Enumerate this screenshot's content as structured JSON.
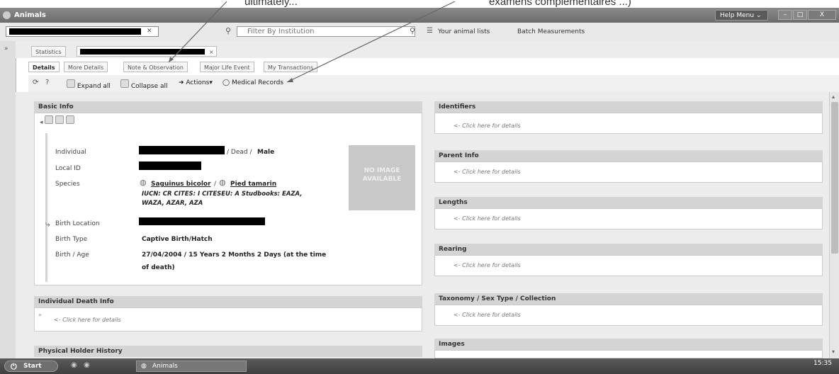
{
  "annotations": {
    "left_fragment": "ultimately...",
    "right_fragment": "examens complémentaires ...)"
  },
  "window": {
    "title": "Animals",
    "help_menu": "Help Menu",
    "min": "–",
    "max": "□",
    "close": "X"
  },
  "toolbar": {
    "filter_placeholder": "Filter By Institution",
    "animal_lists": "Your animal lists",
    "batch_measurements": "Batch Measurements"
  },
  "tabs_top": {
    "statistics": "Statistics",
    "close": "×"
  },
  "tabs": [
    "Details",
    "More Details",
    "Note & Observation",
    "Major Life Event",
    "My Transactions"
  ],
  "actions": {
    "expand_all": "Expand all",
    "collapse_all": "Collapse all",
    "actions": "Actions",
    "medical_records": "Medical Records"
  },
  "basic_info": {
    "header": "Basic Info",
    "labels": {
      "individual": "Individual",
      "local_id": "Local ID",
      "species": "Species",
      "birth_location": "Birth Location",
      "birth_type": "Birth Type",
      "birth_age": "Birth / Age"
    },
    "individual_status": "/ Dead /",
    "sex": "Male",
    "species_1": "Saguinus bicolor",
    "species_sep": "/",
    "species_2": "Pied tamarin",
    "status_line1": "IUCN: CR  CITES: I  CITESEU: A Studbooks: EAZA,",
    "status_line2": "WAZA, AZAR, AZA",
    "birth_type": "Captive Birth/Hatch",
    "birth_age_line1": "27/04/2004 / 15 Years 2 Months 2 Days  (at the time",
    "birth_age_line2": "of death)",
    "no_image_line1": "NO IMAGE",
    "no_image_line2": "AVAILABLE"
  },
  "death_info": {
    "header": "Individual Death Info",
    "click": "<- Click here for details"
  },
  "physical_holder": {
    "header": "Physical Holder History"
  },
  "right_panels": [
    {
      "header": "Identifiers",
      "click": "<- Click here for details"
    },
    {
      "header": "Parent Info",
      "click": "<- Click here for details"
    },
    {
      "header": "Lengths",
      "click": "<- Click here for details"
    },
    {
      "header": "Rearing",
      "click": "<- Click here for details"
    },
    {
      "header": "Taxonomy / Sex Type / Collection",
      "click": "<- Click here for details"
    },
    {
      "header": "Images",
      "click": ""
    }
  ],
  "taskbar": {
    "start": "Start",
    "app": "Animals",
    "time": "15:35"
  }
}
